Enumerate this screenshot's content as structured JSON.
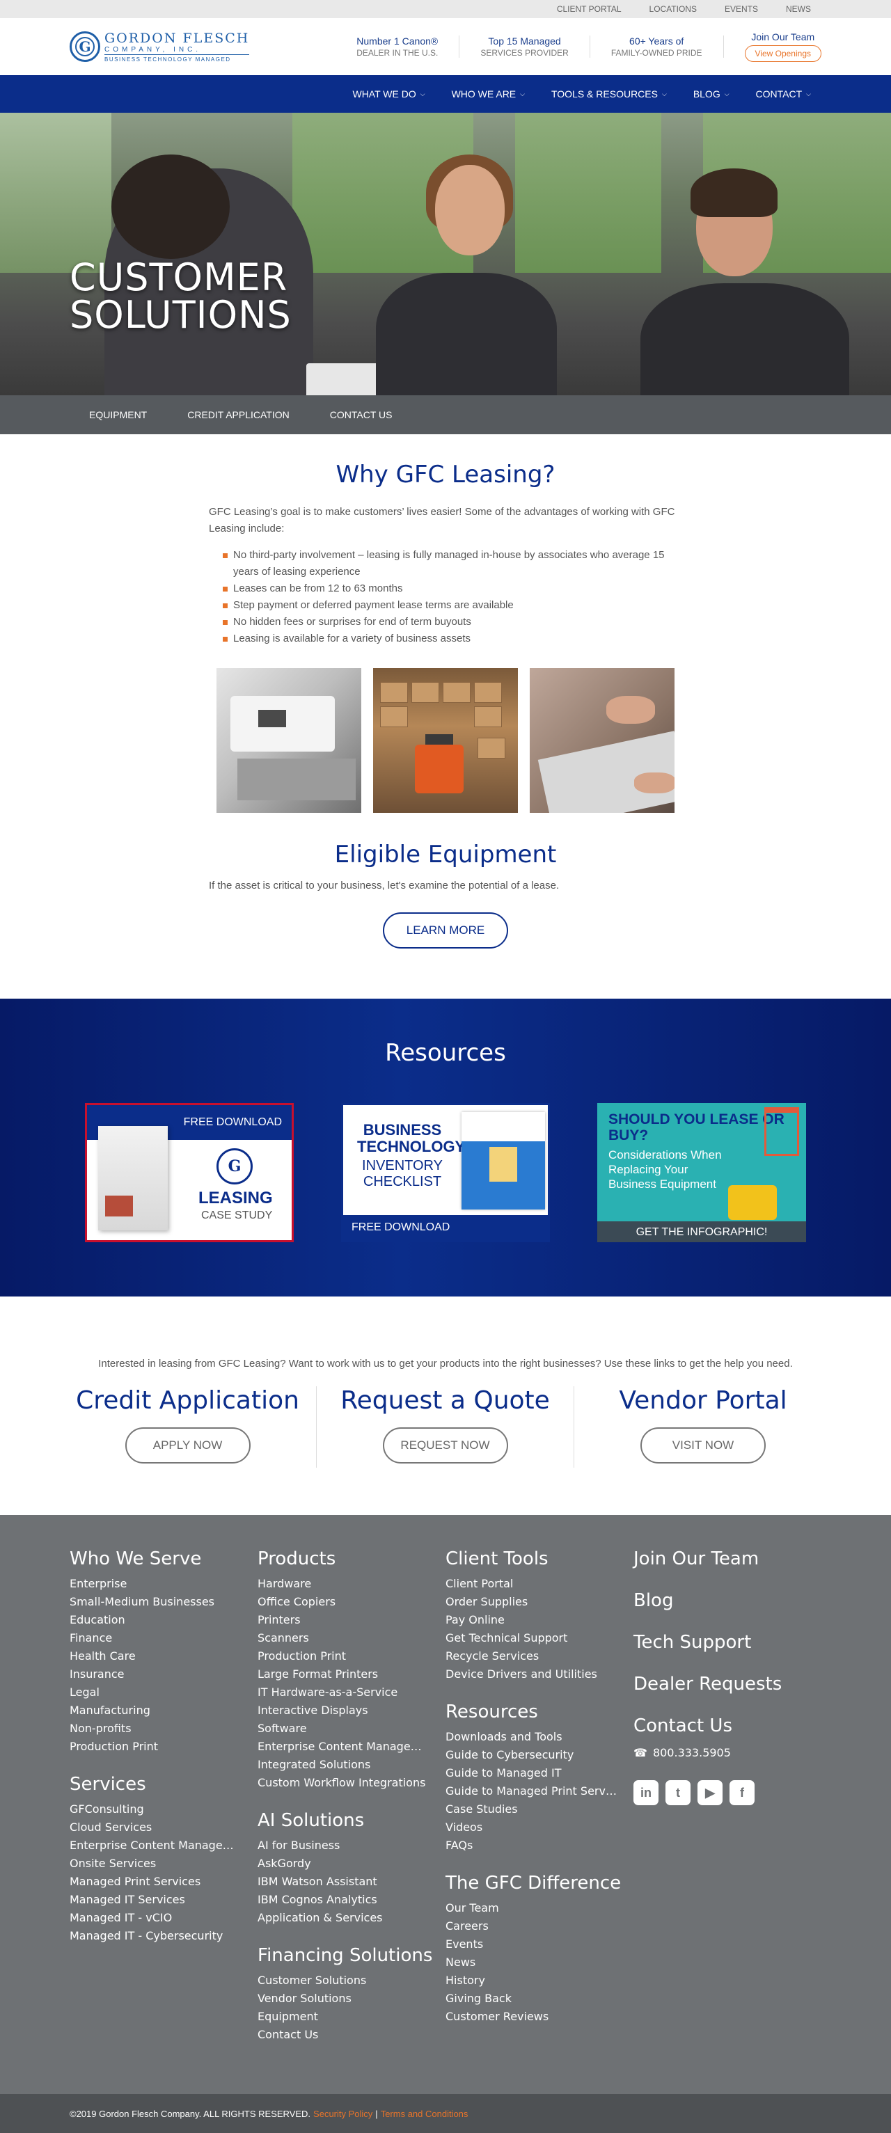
{
  "utility": [
    "CLIENT PORTAL",
    "LOCATIONS",
    "EVENTS",
    "NEWS"
  ],
  "logo": {
    "name": "GORDON FLESCH",
    "sub": "COMPANY, INC.",
    "tag": "BUSINESS TECHNOLOGY MANAGED"
  },
  "stats": [
    {
      "t1": "Number 1 Canon®",
      "t2": "DEALER IN THE U.S."
    },
    {
      "t1": "Top 15 Managed",
      "t2": "SERVICES PROVIDER"
    },
    {
      "t1": "60+ Years of",
      "t2": "FAMILY-OWNED PRIDE"
    }
  ],
  "join": {
    "title": "Join Our Team",
    "button": "View Openings"
  },
  "nav": [
    "WHAT WE DO",
    "WHO WE ARE",
    "TOOLS & RESOURCES",
    "BLOG",
    "CONTACT"
  ],
  "hero": {
    "line1": "CUSTOMER",
    "line2": "SOLUTIONS"
  },
  "subnav": [
    "EQUIPMENT",
    "CREDIT APPLICATION",
    "CONTACT US"
  ],
  "why": {
    "title": "Why GFC Leasing?",
    "intro": "GFC Leasing’s goal is to make customers’ lives easier! Some of the advantages of working with GFC Leasing include:",
    "items": [
      "No third-party involvement – leasing is fully managed in-house by associates who average 15 years of leasing experience",
      "Leases can be from 12 to 63 months",
      "Step payment or deferred payment lease terms are available",
      "No hidden fees or surprises for end of term buyouts",
      "Leasing is available for a variety of business assets"
    ]
  },
  "eligible": {
    "title": "Eligible Equipment",
    "text": "If the asset is critical to your business, let's examine the potential of a lease.",
    "button": "LEARN MORE"
  },
  "resources": {
    "title": "Resources",
    "card1": {
      "top": "FREE DOWNLOAD",
      "big": "LEASING",
      "small": "CASE STUDY"
    },
    "card2": {
      "t1": "BUSINESS TECHNOLOGY",
      "t2": "INVENTORY CHECKLIST",
      "bar": "FREE DOWNLOAD"
    },
    "card3": {
      "q": "SHOULD YOU LEASE OR BUY?",
      "c": "Considerations When Replacing Your Business Equipment",
      "bar": "GET THE INFOGRAPHIC!"
    }
  },
  "links": {
    "lead": "Interested in leasing from GFC Leasing? Want to work with us to get your products into the right businesses? Use these links to get the help you need.",
    "cols": [
      {
        "title": "Credit Application",
        "button": "APPLY NOW"
      },
      {
        "title": "Request a Quote",
        "button": "REQUEST NOW"
      },
      {
        "title": "Vendor Portal",
        "button": "VISIT NOW"
      }
    ]
  },
  "footer": {
    "who": {
      "title": "Who We Serve",
      "items": [
        "Enterprise",
        "Small-Medium Businesses",
        "Education",
        "Finance",
        "Health Care",
        "Insurance",
        "Legal",
        "Manufacturing",
        "Non-profits",
        "Production Print"
      ]
    },
    "services": {
      "title": "Services",
      "items": [
        "GFConsulting",
        "Cloud Services",
        "Enterprise Content Management",
        "Onsite Services",
        "Managed Print Services",
        "Managed IT Services",
        "Managed IT - vCIO",
        "Managed IT - Cybersecurity"
      ]
    },
    "products": {
      "title": "Products",
      "items": [
        "Hardware",
        "Office Copiers",
        "Printers",
        "Scanners",
        "Production Print",
        "Large Format Printers",
        "IT Hardware-as-a-Service",
        "Interactive Displays",
        "Software",
        "Enterprise Content Management",
        "Integrated Solutions",
        "Custom Workflow Integrations"
      ]
    },
    "ai": {
      "title": "AI Solutions",
      "items": [
        "AI for Business",
        "AskGordy",
        "IBM Watson Assistant",
        "IBM Cognos Analytics",
        "Application & Services"
      ]
    },
    "financing": {
      "title": "Financing Solutions",
      "items": [
        "Customer Solutions",
        "Vendor Solutions",
        "Equipment",
        "Contact Us"
      ]
    },
    "client": {
      "title": "Client Tools",
      "items": [
        "Client Portal",
        "Order Supplies",
        "Pay Online",
        "Get Technical Support",
        "Recycle Services",
        "Device Drivers and Utilities"
      ]
    },
    "resources": {
      "title": "Resources",
      "items": [
        "Downloads and Tools",
        "Guide to Cybersecurity",
        "Guide to Managed IT",
        "Guide to Managed Print Services",
        "Case Studies",
        "Videos",
        "FAQs"
      ]
    },
    "difference": {
      "title": "The GFC Difference",
      "items": [
        "Our Team",
        "Careers",
        "Events",
        "News",
        "History",
        "Giving Back",
        "Customer Reviews"
      ]
    },
    "right": {
      "join": "Join Our Team",
      "blog": "Blog",
      "tech": "Tech Support",
      "dealer": "Dealer Requests",
      "contact": "Contact Us",
      "phone": "800.333.5905"
    }
  },
  "copyright": {
    "text": "©2019 Gordon Flesch Company. ALL RIGHTS RESERVED.",
    "policy": "Security Policy",
    "sep": "|",
    "terms": "Terms and Conditions"
  }
}
